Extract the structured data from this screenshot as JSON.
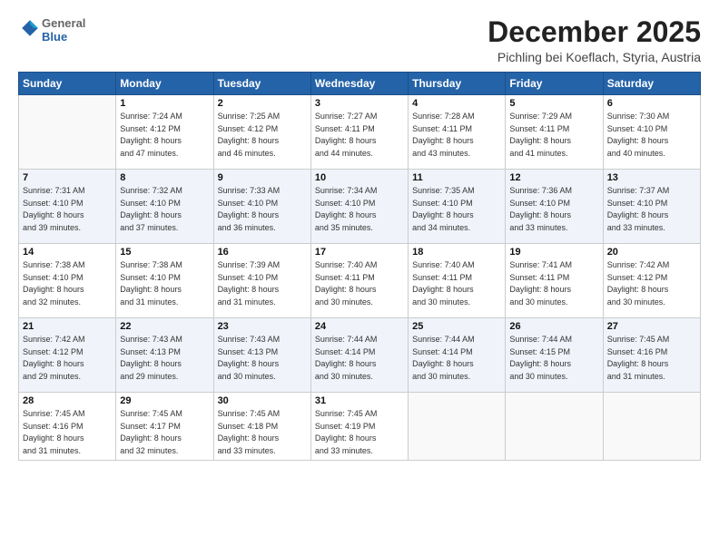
{
  "header": {
    "logo_general": "General",
    "logo_blue": "Blue",
    "month_title": "December 2025",
    "location": "Pichling bei Koeflach, Styria, Austria"
  },
  "weekdays": [
    "Sunday",
    "Monday",
    "Tuesday",
    "Wednesday",
    "Thursday",
    "Friday",
    "Saturday"
  ],
  "weeks": [
    [
      {
        "day": "",
        "info": ""
      },
      {
        "day": "1",
        "info": "Sunrise: 7:24 AM\nSunset: 4:12 PM\nDaylight: 8 hours\nand 47 minutes."
      },
      {
        "day": "2",
        "info": "Sunrise: 7:25 AM\nSunset: 4:12 PM\nDaylight: 8 hours\nand 46 minutes."
      },
      {
        "day": "3",
        "info": "Sunrise: 7:27 AM\nSunset: 4:11 PM\nDaylight: 8 hours\nand 44 minutes."
      },
      {
        "day": "4",
        "info": "Sunrise: 7:28 AM\nSunset: 4:11 PM\nDaylight: 8 hours\nand 43 minutes."
      },
      {
        "day": "5",
        "info": "Sunrise: 7:29 AM\nSunset: 4:11 PM\nDaylight: 8 hours\nand 41 minutes."
      },
      {
        "day": "6",
        "info": "Sunrise: 7:30 AM\nSunset: 4:10 PM\nDaylight: 8 hours\nand 40 minutes."
      }
    ],
    [
      {
        "day": "7",
        "info": "Sunrise: 7:31 AM\nSunset: 4:10 PM\nDaylight: 8 hours\nand 39 minutes."
      },
      {
        "day": "8",
        "info": "Sunrise: 7:32 AM\nSunset: 4:10 PM\nDaylight: 8 hours\nand 37 minutes."
      },
      {
        "day": "9",
        "info": "Sunrise: 7:33 AM\nSunset: 4:10 PM\nDaylight: 8 hours\nand 36 minutes."
      },
      {
        "day": "10",
        "info": "Sunrise: 7:34 AM\nSunset: 4:10 PM\nDaylight: 8 hours\nand 35 minutes."
      },
      {
        "day": "11",
        "info": "Sunrise: 7:35 AM\nSunset: 4:10 PM\nDaylight: 8 hours\nand 34 minutes."
      },
      {
        "day": "12",
        "info": "Sunrise: 7:36 AM\nSunset: 4:10 PM\nDaylight: 8 hours\nand 33 minutes."
      },
      {
        "day": "13",
        "info": "Sunrise: 7:37 AM\nSunset: 4:10 PM\nDaylight: 8 hours\nand 33 minutes."
      }
    ],
    [
      {
        "day": "14",
        "info": "Sunrise: 7:38 AM\nSunset: 4:10 PM\nDaylight: 8 hours\nand 32 minutes."
      },
      {
        "day": "15",
        "info": "Sunrise: 7:38 AM\nSunset: 4:10 PM\nDaylight: 8 hours\nand 31 minutes."
      },
      {
        "day": "16",
        "info": "Sunrise: 7:39 AM\nSunset: 4:10 PM\nDaylight: 8 hours\nand 31 minutes."
      },
      {
        "day": "17",
        "info": "Sunrise: 7:40 AM\nSunset: 4:11 PM\nDaylight: 8 hours\nand 30 minutes."
      },
      {
        "day": "18",
        "info": "Sunrise: 7:40 AM\nSunset: 4:11 PM\nDaylight: 8 hours\nand 30 minutes."
      },
      {
        "day": "19",
        "info": "Sunrise: 7:41 AM\nSunset: 4:11 PM\nDaylight: 8 hours\nand 30 minutes."
      },
      {
        "day": "20",
        "info": "Sunrise: 7:42 AM\nSunset: 4:12 PM\nDaylight: 8 hours\nand 30 minutes."
      }
    ],
    [
      {
        "day": "21",
        "info": "Sunrise: 7:42 AM\nSunset: 4:12 PM\nDaylight: 8 hours\nand 29 minutes."
      },
      {
        "day": "22",
        "info": "Sunrise: 7:43 AM\nSunset: 4:13 PM\nDaylight: 8 hours\nand 29 minutes."
      },
      {
        "day": "23",
        "info": "Sunrise: 7:43 AM\nSunset: 4:13 PM\nDaylight: 8 hours\nand 30 minutes."
      },
      {
        "day": "24",
        "info": "Sunrise: 7:44 AM\nSunset: 4:14 PM\nDaylight: 8 hours\nand 30 minutes."
      },
      {
        "day": "25",
        "info": "Sunrise: 7:44 AM\nSunset: 4:14 PM\nDaylight: 8 hours\nand 30 minutes."
      },
      {
        "day": "26",
        "info": "Sunrise: 7:44 AM\nSunset: 4:15 PM\nDaylight: 8 hours\nand 30 minutes."
      },
      {
        "day": "27",
        "info": "Sunrise: 7:45 AM\nSunset: 4:16 PM\nDaylight: 8 hours\nand 31 minutes."
      }
    ],
    [
      {
        "day": "28",
        "info": "Sunrise: 7:45 AM\nSunset: 4:16 PM\nDaylight: 8 hours\nand 31 minutes."
      },
      {
        "day": "29",
        "info": "Sunrise: 7:45 AM\nSunset: 4:17 PM\nDaylight: 8 hours\nand 32 minutes."
      },
      {
        "day": "30",
        "info": "Sunrise: 7:45 AM\nSunset: 4:18 PM\nDaylight: 8 hours\nand 33 minutes."
      },
      {
        "day": "31",
        "info": "Sunrise: 7:45 AM\nSunset: 4:19 PM\nDaylight: 8 hours\nand 33 minutes."
      },
      {
        "day": "",
        "info": ""
      },
      {
        "day": "",
        "info": ""
      },
      {
        "day": "",
        "info": ""
      }
    ]
  ]
}
